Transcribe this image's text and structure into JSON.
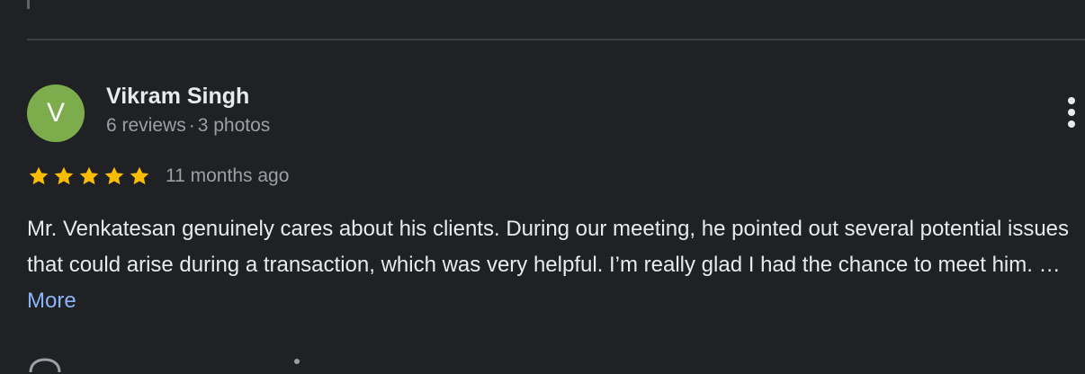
{
  "review": {
    "avatar_letter": "V",
    "avatar_color": "#7cac4b",
    "author_name": "Vikram Singh",
    "review_count": "6 reviews",
    "separator": "·",
    "photo_count": "3 photos",
    "rating": 5,
    "max_rating": 5,
    "star_color": "#fbbc04",
    "time_ago": "11 months ago",
    "text": "Mr. Venkatesan genuinely cares about his clients. During our meeting, he pointed out several potential issues that could arise during a transaction, which was very helpful. I’m really glad I had the chance to meet him. …",
    "more_label": "More",
    "menu_icon": "more-vert-icon"
  }
}
